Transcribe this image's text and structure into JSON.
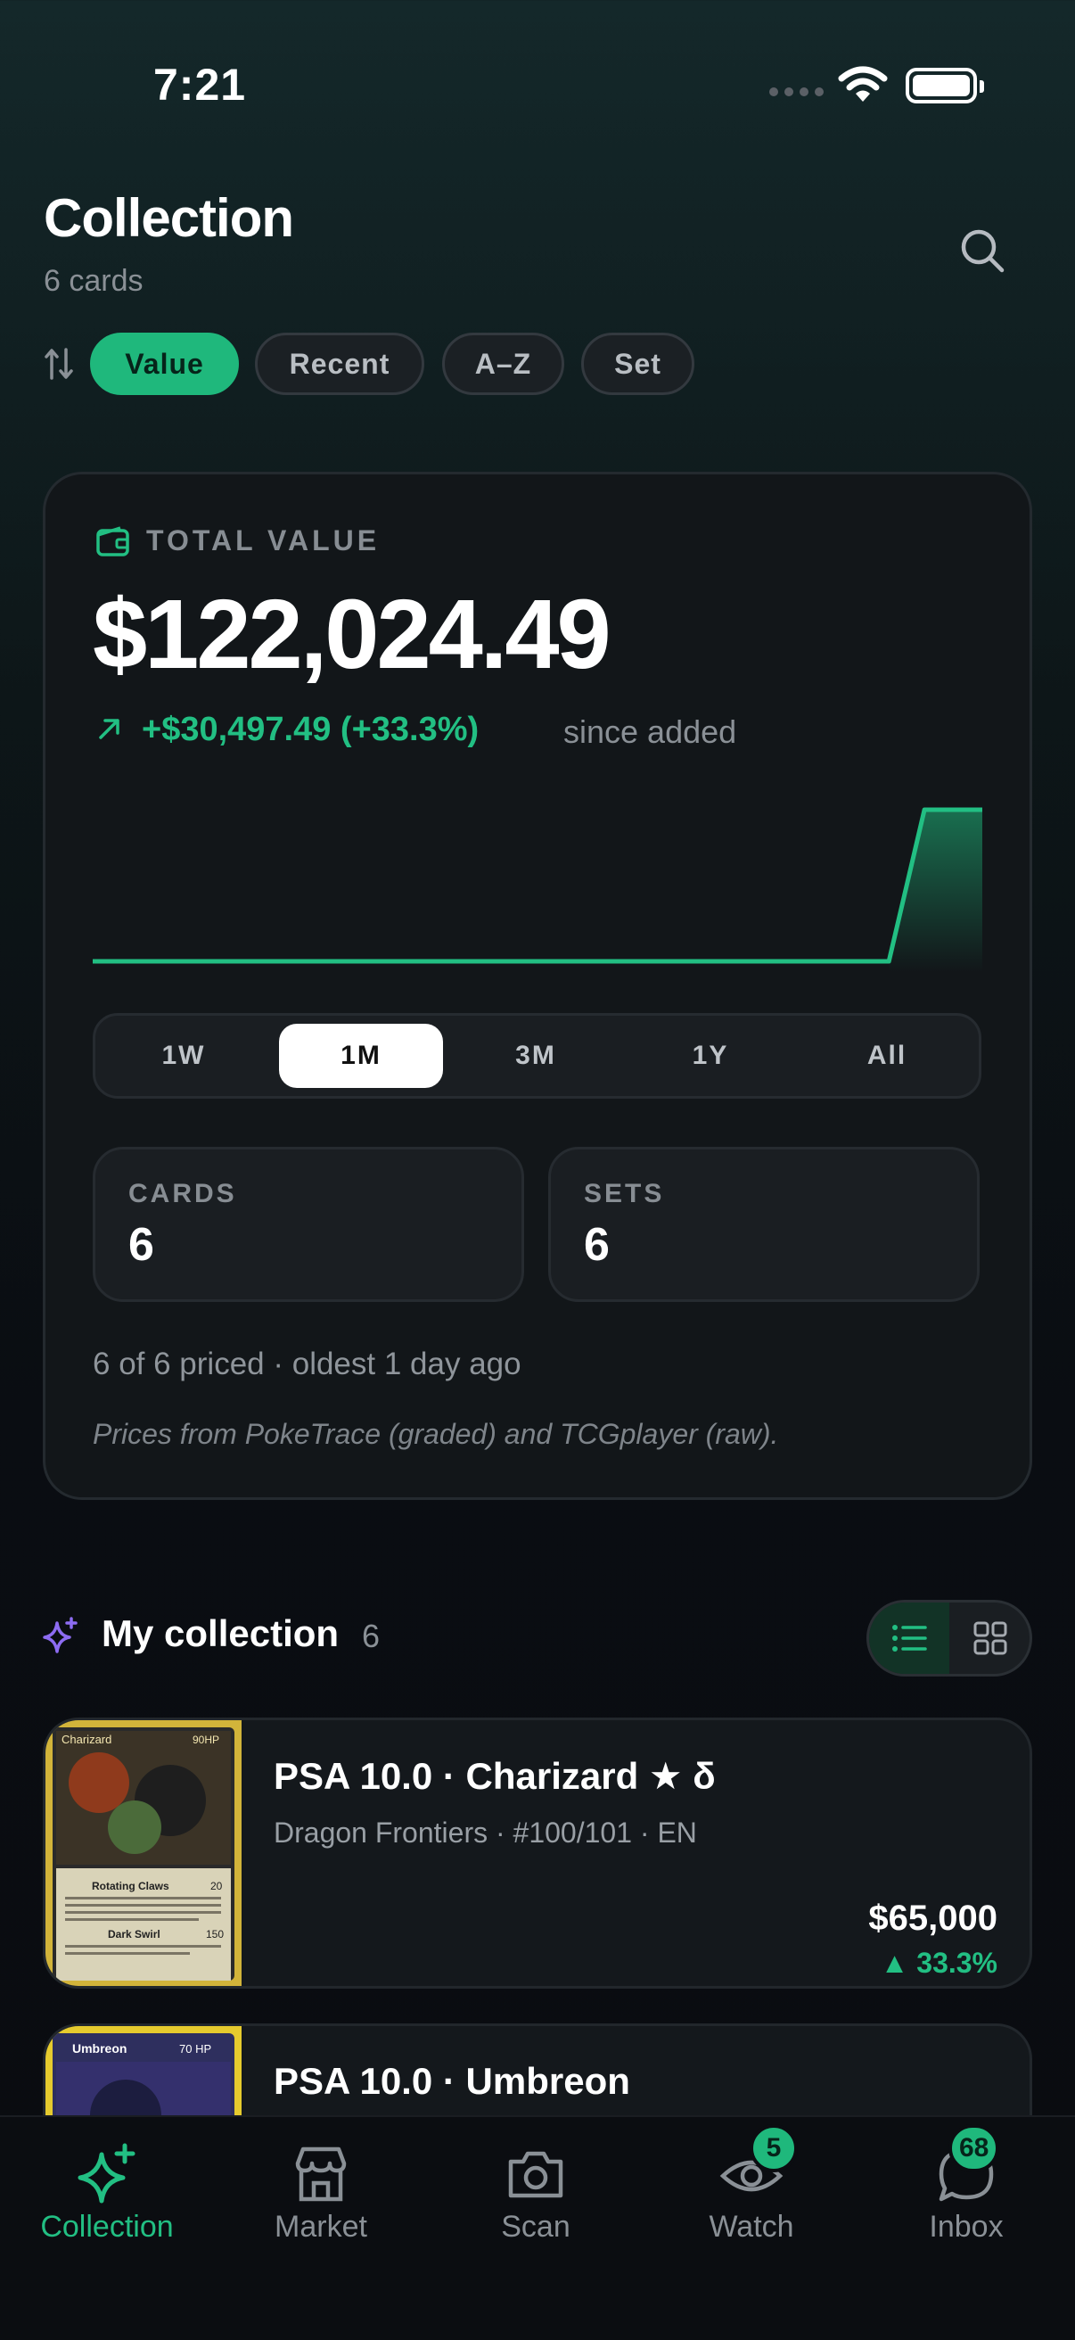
{
  "status_bar": {
    "time": "7:21"
  },
  "header": {
    "title": "Collection",
    "subtitle": "6 cards"
  },
  "sort": {
    "options": [
      "Value",
      "Recent",
      "A–Z",
      "Set"
    ],
    "selected": "Value"
  },
  "summary": {
    "label": "TOTAL VALUE",
    "total": "$122,024.49",
    "gain": "+$30,497.49 (+33.3%)",
    "gain_suffix": "since added",
    "ranges": [
      "1W",
      "1M",
      "3M",
      "1Y",
      "All"
    ],
    "selected_range": "1M",
    "stats": [
      {
        "label": "CARDS",
        "value": "6"
      },
      {
        "label": "SETS",
        "value": "6"
      }
    ],
    "priced_note": "6 of 6 priced · oldest 1 day ago",
    "source_note": "Prices from PokeTrace (graded) and TCGplayer (raw)."
  },
  "chart_data": {
    "type": "area",
    "note_range": "1M",
    "points_description": "flat then sharp rise at end",
    "values": [
      91527,
      91527,
      91527,
      91527,
      91527,
      91527,
      91527,
      91527,
      91527,
      91527,
      122024,
      122024
    ],
    "color": "#22bf83"
  },
  "collection": {
    "title": "My collection",
    "count": "6",
    "view_mode": "list",
    "items": [
      {
        "title": "PSA 10.0 · Charizard ★ δ",
        "subtitle": "Dragon Frontiers · #100/101 · EN",
        "price": "$65,000",
        "change": "▲ 33.3%",
        "thumb_texts": [
          "Charizard",
          "90HP",
          "Rotating Claws",
          "20",
          "Dark Swirl",
          "150"
        ]
      },
      {
        "title": "PSA 10.0 · Umbreon",
        "subtitle": "",
        "price": "",
        "change": "",
        "thumb_texts": [
          "Umbreon",
          "70 HP"
        ]
      }
    ]
  },
  "tabbar": {
    "tabs": [
      {
        "label": "Collection",
        "icon": "sparkle-icon",
        "active": true,
        "badge": ""
      },
      {
        "label": "Market",
        "icon": "storefront-icon",
        "active": false,
        "badge": ""
      },
      {
        "label": "Scan",
        "icon": "camera-icon",
        "active": false,
        "badge": ""
      },
      {
        "label": "Watch",
        "icon": "eye-icon",
        "active": false,
        "badge": "5"
      },
      {
        "label": "Inbox",
        "icon": "chat-bubble-icon",
        "active": false,
        "badge": "68"
      }
    ]
  },
  "colors": {
    "accent": "#1fb87c",
    "gain": "#22bf83",
    "background": "#0a0c10"
  }
}
